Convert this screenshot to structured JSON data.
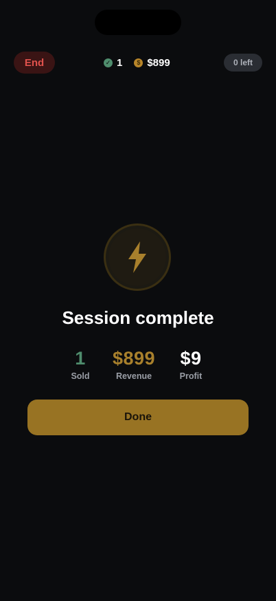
{
  "header": {
    "end_label": "End",
    "sold_count": "1",
    "revenue": "$899",
    "remaining_label": "0 left"
  },
  "summary": {
    "title": "Session complete",
    "stats": {
      "sold": {
        "value": "1",
        "label": "Sold"
      },
      "revenue": {
        "value": "$899",
        "label": "Revenue"
      },
      "profit": {
        "value": "$9",
        "label": "Profit"
      }
    },
    "done_label": "Done"
  },
  "colors": {
    "background": "#0b0c0e",
    "accent_gold": "#987323",
    "success_green": "#4f8d6d",
    "danger_red": "#e0524d"
  },
  "icons": {
    "check": "check-circle-icon",
    "coin": "dollar-coin-icon",
    "bolt": "lightning-bolt-icon"
  }
}
